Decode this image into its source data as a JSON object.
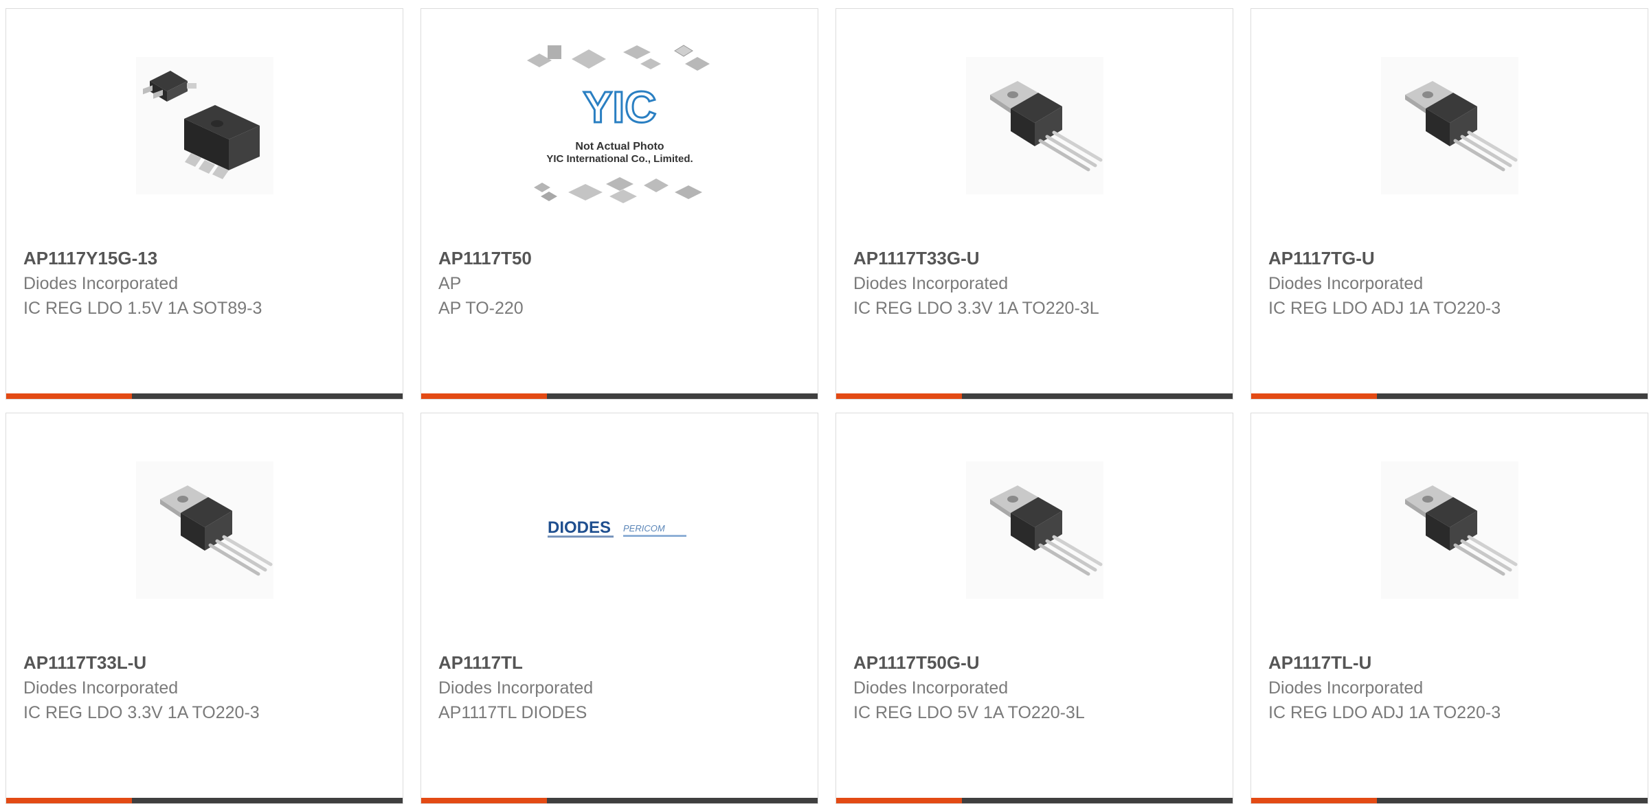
{
  "colors": {
    "accent": "#e34a14",
    "bar": "#3f3f3f",
    "part_number": "#555555",
    "text": "#7a7a7a",
    "border": "#dcdcdc"
  },
  "products": [
    {
      "part_number": "AP1117Y15G-13",
      "manufacturer": "Diodes Incorporated",
      "description": "IC REG LDO 1.5V 1A SOT89-3",
      "image": "sot89-package-photo"
    },
    {
      "part_number": "AP1117T50",
      "manufacturer": "AP",
      "description": "AP TO-220",
      "image": "not-actual-photo-placeholder",
      "placeholder_text": {
        "line1": "Not Actual Photo",
        "line2": "YIC International Co., Limited.",
        "logo": "YIC"
      }
    },
    {
      "part_number": "AP1117T33G-U",
      "manufacturer": "Diodes Incorporated",
      "description": "IC REG LDO 3.3V 1A TO220-3L",
      "image": "to220-package-photo"
    },
    {
      "part_number": "AP1117TG-U",
      "manufacturer": "Diodes Incorporated",
      "description": "IC REG LDO ADJ 1A TO220-3",
      "image": "to220-package-photo"
    },
    {
      "part_number": "AP1117T33L-U",
      "manufacturer": "Diodes Incorporated",
      "description": "IC REG LDO 3.3V 1A TO220-3",
      "image": "to220-package-photo"
    },
    {
      "part_number": "AP1117TL",
      "manufacturer": "Diodes Incorporated",
      "description": "AP1117TL DIODES",
      "image": "diodes-pericom-logo",
      "logo_text": {
        "primary": "DIODES",
        "secondary": "PERICOM"
      }
    },
    {
      "part_number": "AP1117T50G-U",
      "manufacturer": "Diodes Incorporated",
      "description": "IC REG LDO 5V 1A TO220-3L",
      "image": "to220-package-photo"
    },
    {
      "part_number": "AP1117TL-U",
      "manufacturer": "Diodes Incorporated",
      "description": "IC REG LDO ADJ 1A TO220-3",
      "image": "to220-package-photo"
    }
  ]
}
